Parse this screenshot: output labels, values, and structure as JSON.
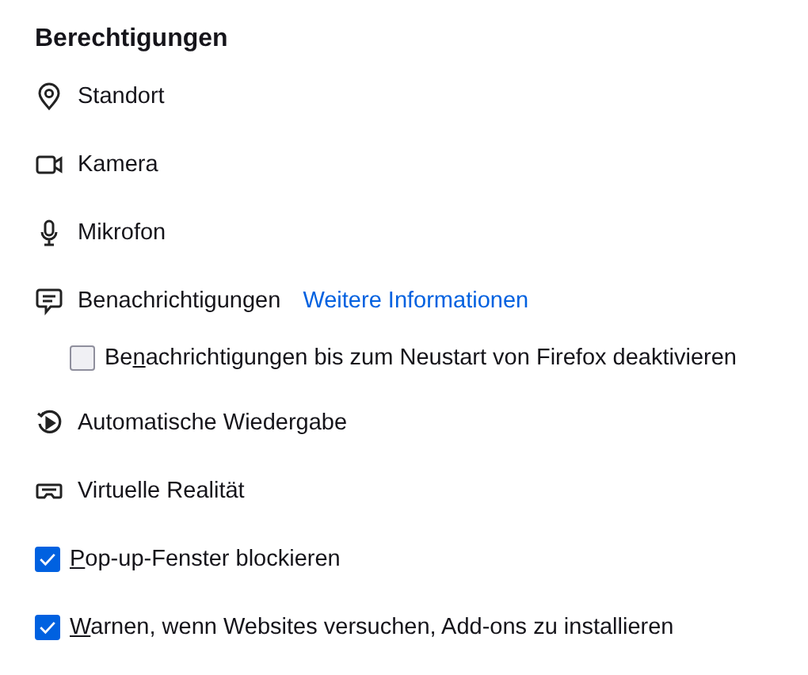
{
  "heading": "Berechtigungen",
  "permissions": [
    {
      "label": "Standort"
    },
    {
      "label": "Kamera"
    },
    {
      "label": "Mikrofon"
    },
    {
      "label": "Benachrichtigungen",
      "link": "Weitere Informationen",
      "option": {
        "checked": false,
        "label_before": "Be",
        "accesskey": "n",
        "label_after": "achrichtigungen bis zum Neustart von Firefox deaktivieren"
      }
    },
    {
      "label": "Automatische Wiedergabe"
    },
    {
      "label": "Virtuelle Realität"
    }
  ],
  "checkboxes": [
    {
      "checked": true,
      "accesskey": "P",
      "label_after": "op-up-Fenster blockieren"
    },
    {
      "checked": true,
      "accesskey": "W",
      "label_after": "arnen, wenn Websites versuchen, Add-ons zu installieren"
    }
  ]
}
